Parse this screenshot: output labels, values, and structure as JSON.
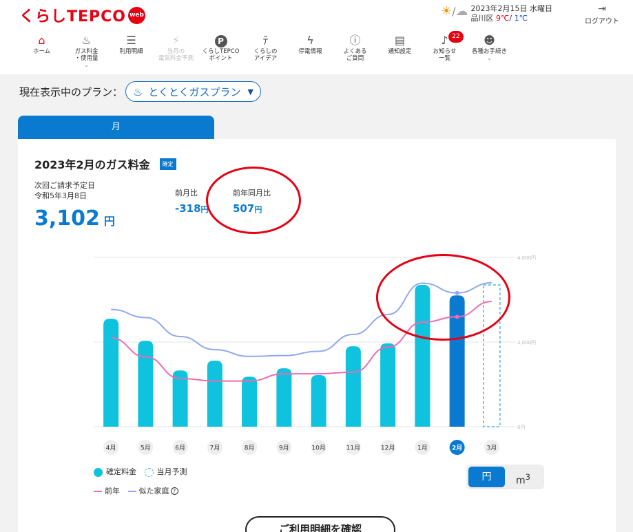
{
  "header": {
    "logo_text": "くらしTEPCO",
    "logo_web": "web",
    "weather": {
      "date": "2023年2月15日 水曜日",
      "area": "品川区",
      "high": "9℃",
      "sep": "/",
      "low": "1℃"
    },
    "logout_label": "ログアウト"
  },
  "nav": [
    {
      "label": "ホーム",
      "icon": "home-icon"
    },
    {
      "label": "ガス料金\n・使用量",
      "icon": "flame-icon"
    },
    {
      "label": "利用明細",
      "icon": "document-icon"
    },
    {
      "label": "当月の\n電気料金予測",
      "icon": "forecast-icon"
    },
    {
      "label": "くらしTEPCO\nポイント",
      "icon": "points-icon"
    },
    {
      "label": "くらしの\nアイデア",
      "icon": "idea-icon"
    },
    {
      "label": "停電情報",
      "icon": "lightning-icon"
    },
    {
      "label": "よくある\nご質問",
      "icon": "question-icon"
    },
    {
      "label": "通知設定",
      "icon": "message-icon"
    },
    {
      "label": "お知らせ\n一覧",
      "icon": "bell-icon",
      "badge": "22"
    },
    {
      "label": "各種お手続き",
      "icon": "user-icon"
    }
  ],
  "plan": {
    "label": "現在表示中のプラン：",
    "name": "とくとくガスプラン"
  },
  "tab_label": "月",
  "summary": {
    "title": "2023年2月のガス料金",
    "status_badge": "確定",
    "due_label": "次回ご請求予定日",
    "due_date": "令和5年3月8日",
    "amount": "3,102",
    "amount_unit": "円",
    "prev_month_label": "前月比",
    "prev_month_value": "-318",
    "prev_year_label": "前年同月比",
    "prev_year_value": "507",
    "yen": "円"
  },
  "chart_data": {
    "type": "bar",
    "categories": [
      "4月",
      "5月",
      "6月",
      "7月",
      "8月",
      "9月",
      "10月",
      "11月",
      "12月",
      "1月",
      "2月",
      "3月"
    ],
    "series": [
      {
        "name": "確定料金",
        "type": "bar",
        "values": [
          2550,
          2030,
          1330,
          1560,
          1180,
          1380,
          1220,
          1900,
          1970,
          3350,
          3102,
          null
        ]
      },
      {
        "name": "当月予測",
        "type": "bar-dashed",
        "values": [
          null,
          null,
          null,
          null,
          null,
          null,
          null,
          null,
          null,
          null,
          null,
          3350
        ]
      },
      {
        "name": "前年",
        "type": "line",
        "values": [
          2100,
          1650,
          1140,
          1080,
          1080,
          1250,
          1250,
          1290,
          1880,
          2470,
          2595,
          2960
        ]
      },
      {
        "name": "似た家庭",
        "type": "line",
        "values": [
          2770,
          2580,
          2130,
          1820,
          1660,
          1680,
          1780,
          2180,
          2650,
          3390,
          3160,
          3400
        ]
      }
    ],
    "yticks": [
      "0円",
      "2,000円",
      "4,000円"
    ],
    "ylim": [
      0,
      4000
    ],
    "selected_category": "2月",
    "colors": {
      "bar": "#0fc2dd",
      "selected_bar": "#0a7ad0",
      "prev_year": "#f06ab0",
      "similar": "#8fa8f0"
    }
  },
  "legend": {
    "confirmed": "確定料金",
    "forecast": "当月予測",
    "prev_year": "前年",
    "similar": "似た家庭"
  },
  "units": {
    "yen": "円",
    "m3": "m",
    "m3_sup": "3"
  },
  "confirm_button": "ご利用明細を確認"
}
